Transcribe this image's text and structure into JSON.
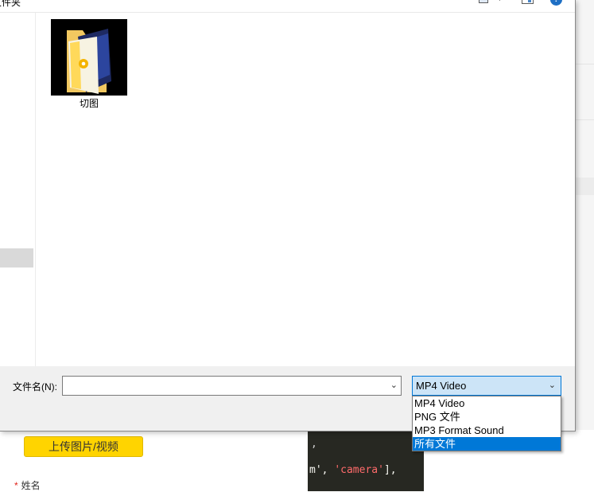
{
  "dialog": {
    "toolbar": {
      "title_partial": "文件夹",
      "help_icon": "help-icon",
      "view_icon": "view-options-icon",
      "pane_icon": "preview-pane-icon"
    },
    "files": [
      {
        "name": "切图",
        "icon": "folder-icon"
      }
    ],
    "filename": {
      "label": "文件名(N):",
      "value": ""
    },
    "filetype": {
      "selected": "MP4 Video",
      "options": [
        "MP4 Video",
        "PNG 文件",
        "MP3 Format Sound",
        "所有文件"
      ],
      "highlighted_index": 3
    },
    "colors": {
      "accent": "#0078d7",
      "select_bg": "#cce4f7"
    }
  },
  "page": {
    "upload_button": "上传图片/视频",
    "name_label": "姓名",
    "required_mark": "*",
    "upload_color": "#ffd400",
    "code": {
      "line1": ",",
      "line2_prefix": "m', ",
      "line2_string": "'camera'",
      "line2_suffix": "],"
    }
  }
}
